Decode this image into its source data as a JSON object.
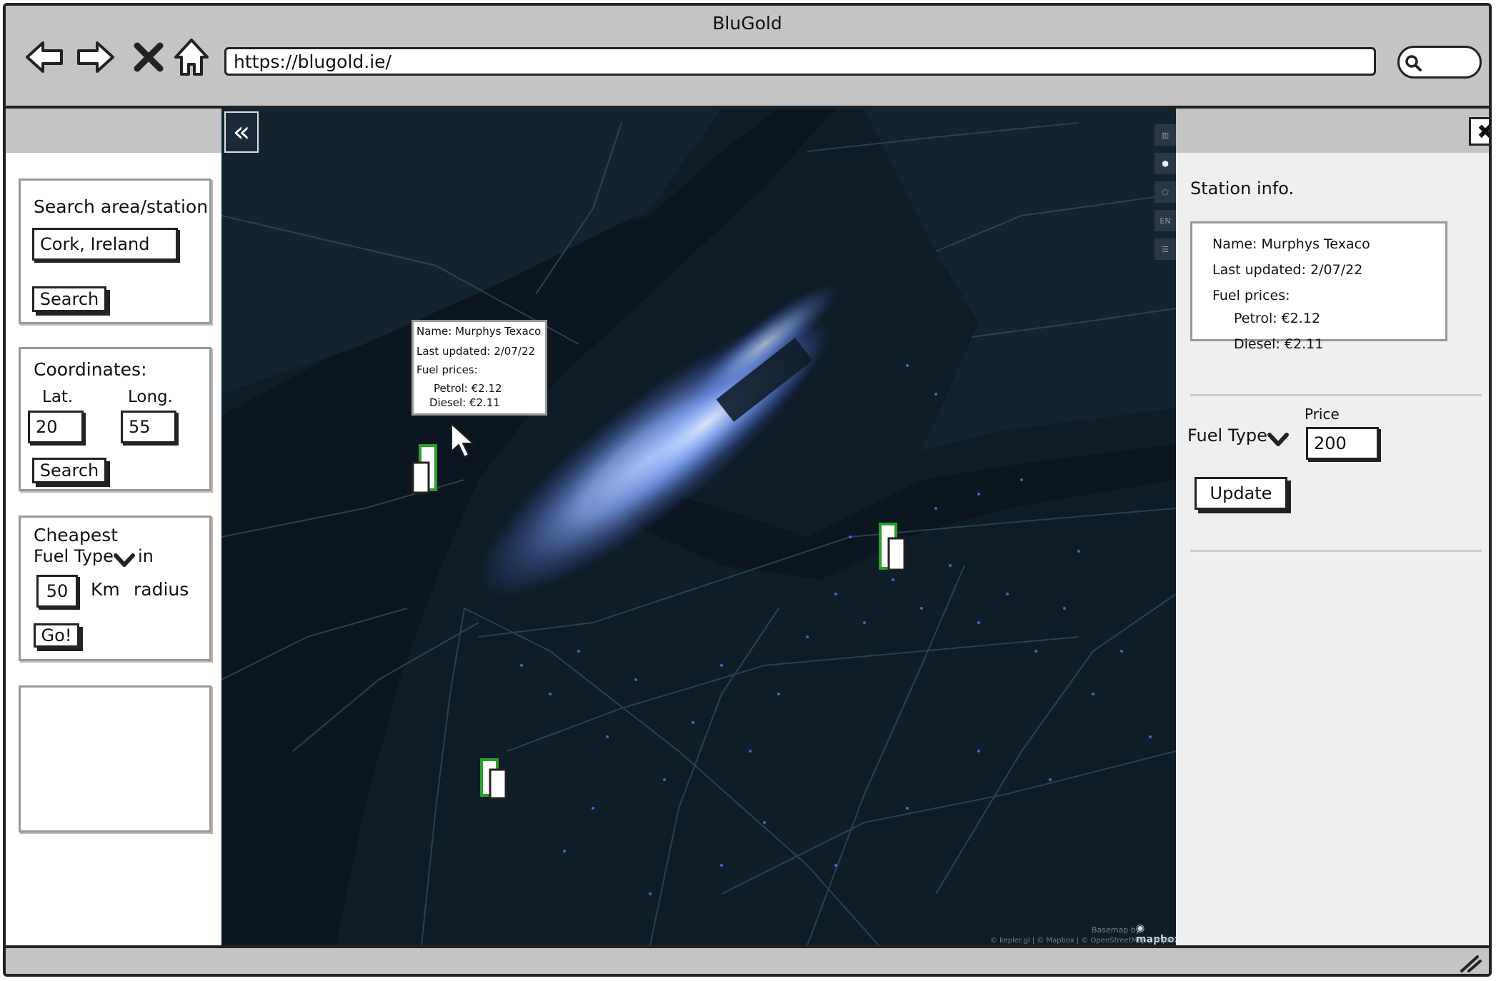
{
  "browser": {
    "title": "BluGold",
    "url": "https://blugold.ie/"
  },
  "left": {
    "search": {
      "label": "Search area/station",
      "value": "Cork, Ireland",
      "button": "Search"
    },
    "coordinates": {
      "label": "Coordinates:",
      "lat_label": "Lat.",
      "lat_value": "20",
      "long_label": "Long.",
      "long_value": "55",
      "button": "Search"
    },
    "cheapest": {
      "title": "Cheapest",
      "fuel_type": "Fuel Type",
      "in": "in",
      "radius_value": "50",
      "km": "Km",
      "radius": "radius",
      "button": "Go!"
    }
  },
  "map": {
    "tooltip": {
      "name": "Name: Murphys Texaco",
      "updated": "Last updated: 2/07/22",
      "fuel": "Fuel prices:",
      "petrol": "Petrol: €2.12",
      "diesel": "Diesel: €2.11"
    },
    "controls": [
      "",
      "",
      "",
      "EN",
      ""
    ],
    "basemap": "Basemap by:",
    "mapbox": "mapbox",
    "attribution": "© kepler.gl | © Mapbox | © OpenStreetMap | Improve this map"
  },
  "right": {
    "heading": "Station info.",
    "name": "Name: Murphys Texaco",
    "updated": "Last updated: 2/07/22",
    "fuel": "Fuel prices:",
    "petrol": "Petrol: €2.12",
    "diesel": "Diesel: €2.11",
    "fuel_type": "Fuel Type",
    "price_label": "Price",
    "price_value": "200",
    "update_button": "Update"
  },
  "colors": {
    "map_bg": "#0f1d28",
    "road": "#2d4657",
    "light": "#7aa7ff",
    "marker": "#2ba02b"
  }
}
